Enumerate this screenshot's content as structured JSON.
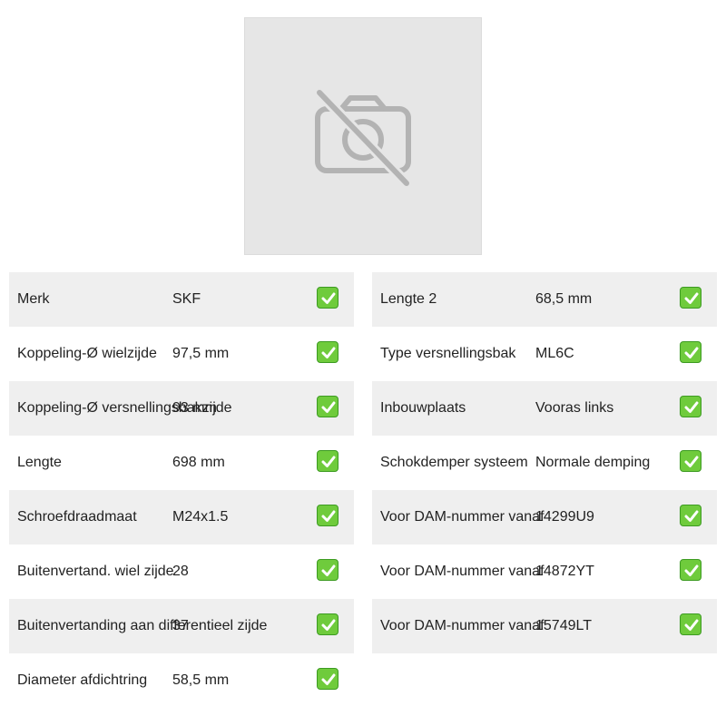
{
  "image": {
    "icon": "camera-off-icon"
  },
  "colors": {
    "row_shade": "#efefef",
    "check_green": "#6fcb3c",
    "placeholder_bg": "#e6e6e6"
  },
  "left_table": [
    {
      "label": "Merk",
      "value": "SKF"
    },
    {
      "label": "Koppeling-Ø wielzijde",
      "value": "97,5 mm"
    },
    {
      "label": "Koppeling-Ø versnellingsbakzijde",
      "value": "93 mm"
    },
    {
      "label": "Lengte",
      "value": "698 mm"
    },
    {
      "label": "Schroefdraadmaat",
      "value": "M24x1.5"
    },
    {
      "label": "Buitenvertand. wiel zijde",
      "value": "28"
    },
    {
      "label": "Buitenvertanding aan differentieel zijde",
      "value": "37"
    },
    {
      "label": "Diameter afdichtring",
      "value": "58,5 mm"
    }
  ],
  "right_table": [
    {
      "label": "Lengte 2",
      "value": "68,5 mm"
    },
    {
      "label": "Type versnellingsbak",
      "value": "ML6C"
    },
    {
      "label": "Inbouwplaats",
      "value": "Vooras links"
    },
    {
      "label": "Schokdemper systeem",
      "value": "Normale demping"
    },
    {
      "label": "Voor DAM-nummer vanaf",
      "value": "14299U9"
    },
    {
      "label": "Voor DAM-nummer vanaf",
      "value": "14872YT"
    },
    {
      "label": "Voor DAM-nummer vanaf",
      "value": "15749LT"
    }
  ]
}
